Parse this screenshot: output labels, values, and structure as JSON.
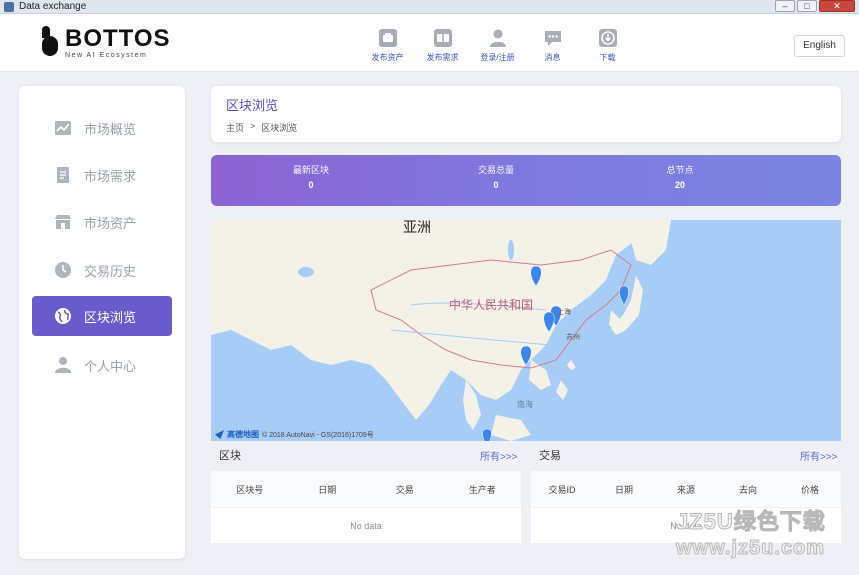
{
  "window": {
    "title": "Data exchange",
    "minimize": "–",
    "maximize": "□",
    "close": "✕"
  },
  "brand": {
    "name": "BOTTOS",
    "tagline": "New AI Ecosystem"
  },
  "topnav": [
    {
      "label": "发布资产",
      "icon": "publish-asset-icon"
    },
    {
      "label": "发布需求",
      "icon": "publish-demand-icon"
    },
    {
      "label": "登录/注册",
      "icon": "user-icon"
    },
    {
      "label": "消息",
      "icon": "message-icon"
    },
    {
      "label": "下载",
      "icon": "download-icon"
    }
  ],
  "language_button": "English",
  "sidebar": {
    "items": [
      {
        "label": "市场概览",
        "icon": "chart-icon"
      },
      {
        "label": "市场需求",
        "icon": "document-icon"
      },
      {
        "label": "市场资产",
        "icon": "store-icon"
      },
      {
        "label": "交易历史",
        "icon": "clock-icon"
      },
      {
        "label": "区块浏览",
        "icon": "globe-icon",
        "active": true
      },
      {
        "label": "个人中心",
        "icon": "person-icon"
      }
    ]
  },
  "page": {
    "title": "区块浏览",
    "breadcrumb": {
      "home": "主页",
      "separator": ">",
      "current": "区块浏览"
    }
  },
  "stats": [
    {
      "label": "最新区块",
      "value": "0"
    },
    {
      "label": "交易总量",
      "value": "0"
    },
    {
      "label": "总节点",
      "value": "20"
    }
  ],
  "map": {
    "region_label": "亚洲",
    "country_label": "中华人民共和国",
    "sea_label": "南海",
    "city_labels": [
      "上海",
      "苏州"
    ],
    "copyright": "© 2018 AutoNavi - GS(2016)1709号",
    "provider": "高德地图",
    "marker_count": 6
  },
  "blocks_table": {
    "title": "区块",
    "more": "所有>>>",
    "columns": [
      "区块号",
      "日期",
      "交易",
      "生产者"
    ],
    "empty": "No data"
  },
  "tx_table": {
    "title": "交易",
    "more": "所有>>>",
    "columns": [
      "交易ID",
      "日期",
      "来源",
      "去向",
      "价格"
    ],
    "empty": "No data"
  },
  "watermark": {
    "line1": "JZ5U绿色下载",
    "line2": "www.jz5u.com"
  },
  "colors": {
    "accent": "#6a5bcb",
    "gradient_start": "#8c63d2",
    "gradient_end": "#7b84e0",
    "sea": "#a7cdf6",
    "land": "#f4f1e8",
    "marker": "#3b86e6"
  }
}
